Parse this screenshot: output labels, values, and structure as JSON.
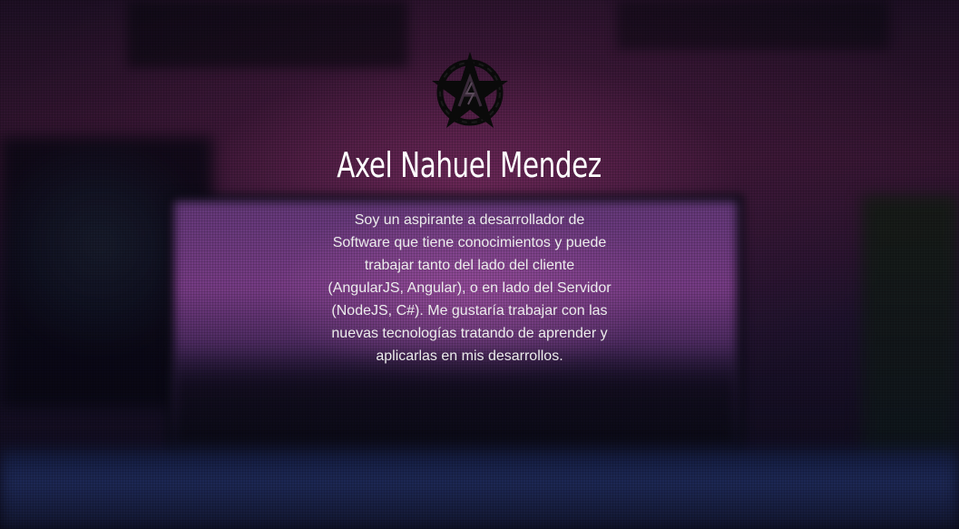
{
  "profile": {
    "name": "Axel Nahuel Mendez",
    "bio": "Soy un aspirante a desarrollador de Software que tiene conocimientos y puede trabajar tanto del lado del cliente (AngularJS, Angular), o en lado del Servidor (NodeJS, C#). Me gustaría trabajar con las nuevas tecnologías tratando de aprender y aplicarlas en mis desarrollos."
  },
  "logo": {
    "icon": "pentagram-star-logo-icon",
    "color": "#0a0a0a"
  },
  "colors": {
    "title": "#ffffff",
    "text": "#ececec"
  }
}
